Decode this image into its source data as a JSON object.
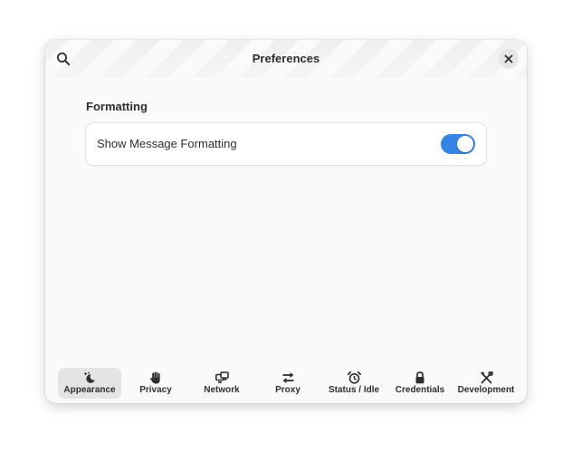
{
  "window": {
    "title": "Preferences"
  },
  "header": {
    "search_icon": "search-icon",
    "close_icon": "close-icon"
  },
  "content": {
    "section_title": "Formatting",
    "rows": [
      {
        "label": "Show Message Formatting",
        "toggle_on": true
      }
    ]
  },
  "nav": {
    "items": [
      {
        "label": "Appearance",
        "icon": "appearance-icon",
        "active": true
      },
      {
        "label": "Privacy",
        "icon": "hand-icon",
        "active": false
      },
      {
        "label": "Network",
        "icon": "network-icon",
        "active": false
      },
      {
        "label": "Proxy",
        "icon": "arrows-swap-icon",
        "active": false
      },
      {
        "label": "Status / Idle",
        "icon": "alarm-clock-icon",
        "active": false
      },
      {
        "label": "Credentials",
        "icon": "lock-icon",
        "active": false
      },
      {
        "label": "Development",
        "icon": "tools-icon",
        "active": false
      }
    ]
  },
  "colors": {
    "accent": "#3584e4",
    "window_bg": "#fafafa",
    "text": "#2e2e2e",
    "active_nav_bg": "#e4e4e4"
  }
}
